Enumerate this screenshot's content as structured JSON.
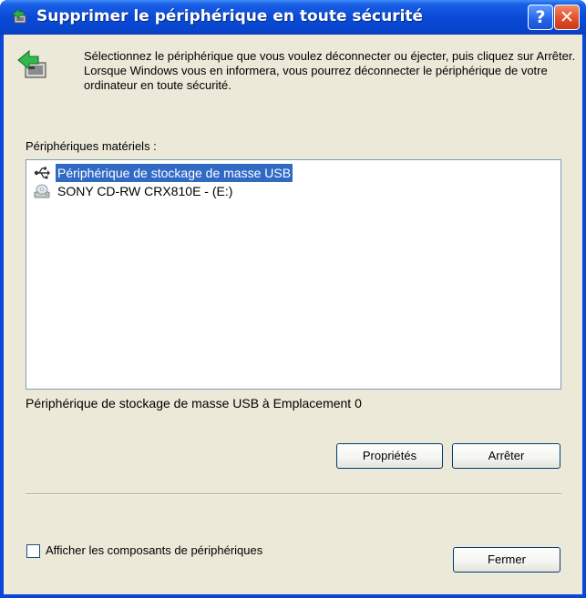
{
  "window": {
    "title": "Supprimer le périphérique en toute sécurité",
    "help_label": "?",
    "close_label": "✕"
  },
  "intro": {
    "text": "Sélectionnez le périphérique que vous voulez déconnecter ou éjecter, puis cliquez sur Arrêter. Lorsque Windows vous en informera, vous pourrez déconnecter le périphérique de votre ordinateur en toute sécurité."
  },
  "devices": {
    "caption": "Périphériques matériels :",
    "items": [
      {
        "label": "Périphérique de stockage de masse USB",
        "icon": "usb-icon",
        "selected": true
      },
      {
        "label": "SONY CD-RW  CRX810E - (E:)",
        "icon": "cd-drive-icon",
        "selected": false
      }
    ]
  },
  "status": {
    "text": "Périphérique de stockage de masse USB à Emplacement 0"
  },
  "buttons": {
    "properties": "Propriétés",
    "stop": "Arrêter",
    "close": "Fermer"
  },
  "options": {
    "show_components_label": "Afficher les composants de périphériques",
    "show_components_checked": false
  },
  "colors": {
    "titlebar": "#0a4ad6",
    "selection": "#316ac5",
    "dialog_bg": "#ece9d8"
  }
}
